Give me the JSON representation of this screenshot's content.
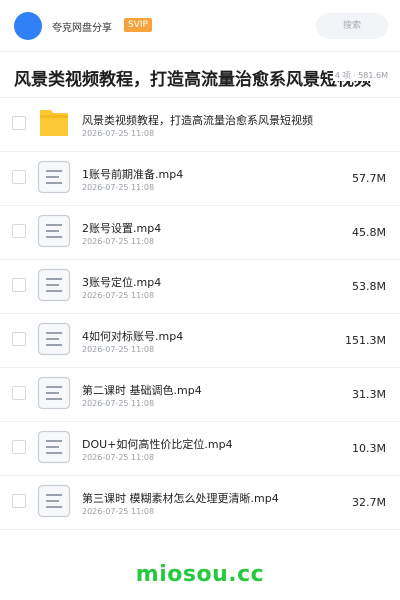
{
  "header": {
    "share_name": "夸克网盘分享",
    "badge": "SVIP",
    "search_placeholder": "搜索"
  },
  "folder": {
    "title": "风景类视频教程，打造高流量治愈系风景短视频",
    "meta": "4 项 · 581.6M"
  },
  "items": [
    {
      "type": "folder",
      "name": "风景类视频教程，打造高流量治愈系风景短视频",
      "date": "2026-07-25 11:08",
      "size": ""
    },
    {
      "type": "file",
      "name": "1账号前期准备.mp4",
      "date": "2026-07-25 11:08",
      "size": "57.7M"
    },
    {
      "type": "file",
      "name": "2账号设置.mp4",
      "date": "2026-07-25 11:08",
      "size": "45.8M"
    },
    {
      "type": "file",
      "name": "3账号定位.mp4",
      "date": "2026-07-25 11:08",
      "size": "53.8M"
    },
    {
      "type": "file",
      "name": "4如何对标账号.mp4",
      "date": "2026-07-25 11:08",
      "size": "151.3M"
    },
    {
      "type": "file",
      "name": "第二课时 基础调色.mp4",
      "date": "2026-07-25 11:08",
      "size": "31.3M"
    },
    {
      "type": "file",
      "name": "DOU+如何高性价比定位.mp4",
      "date": "2026-07-25 11:08",
      "size": "10.3M"
    },
    {
      "type": "file",
      "name": "第三课时 模糊素材怎么处理更清晰.mp4",
      "date": "2026-07-25 11:08",
      "size": "32.7M"
    }
  ],
  "watermark": "miosou.cc",
  "colors": {
    "avatar": "#2f7ff5",
    "svip": "#f7a23b",
    "folder_icon": "#fcc934",
    "watermark": "#27c93f"
  }
}
